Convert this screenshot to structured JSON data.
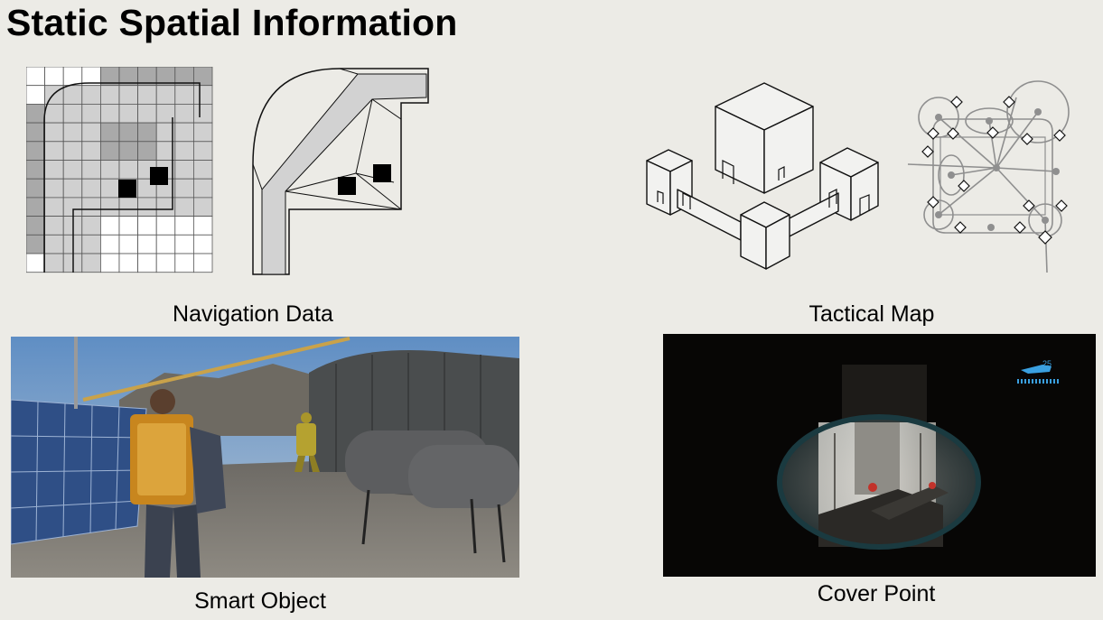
{
  "slide": {
    "title": "Static Spatial Information"
  },
  "panels": {
    "navigation": {
      "caption": "Navigation Data"
    },
    "tactical": {
      "caption": "Tactical Map"
    },
    "smart_object": {
      "caption": "Smart Object"
    },
    "cover_point": {
      "caption": "Cover Point",
      "hud_ammo": "25"
    }
  },
  "colors": {
    "background": "#ecebe6",
    "grid_blocked": "#a9a9a9",
    "grid_walkable": "#d0d0d0",
    "hud_blue": "#3aa0e0"
  }
}
